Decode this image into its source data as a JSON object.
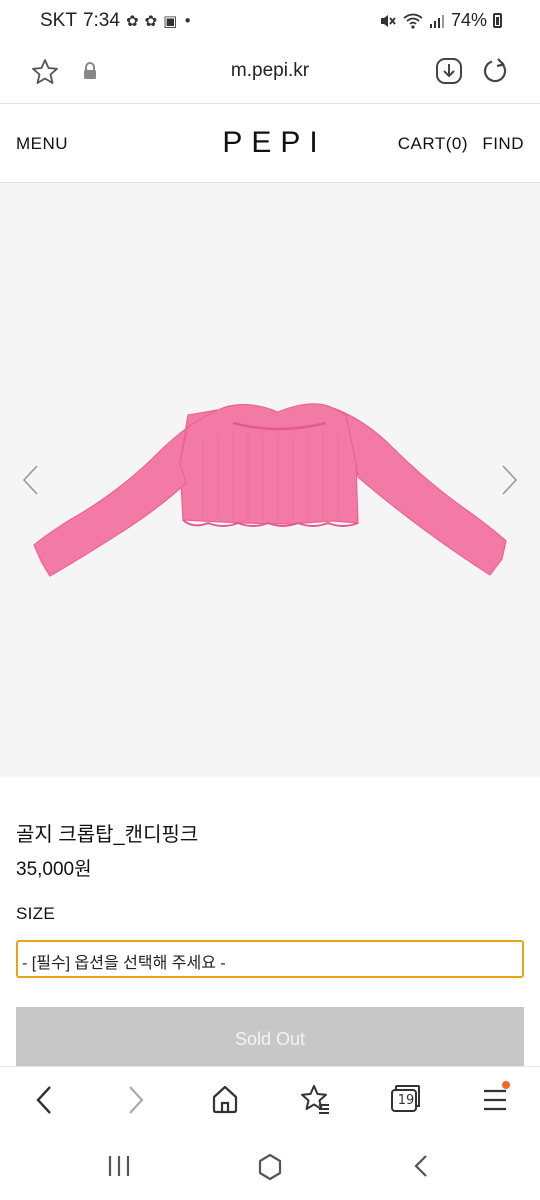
{
  "status_bar": {
    "carrier": "SKT",
    "time": "7:34",
    "battery": "74%"
  },
  "browser": {
    "url": "m.pepi.kr",
    "tab_count": "19"
  },
  "header": {
    "menu": "MENU",
    "logo": "PEPI",
    "cart": "CART(0)",
    "find": "FIND"
  },
  "product": {
    "name": "골지 크롭탑_캔디핑크",
    "price": "35,000원",
    "size_label": "SIZE",
    "size_option": "- [필수] 옵션을 선택해 주세요 -",
    "button": "Sold Out",
    "garment_color": "#f47aa6"
  },
  "colors": {
    "select_border": "#e8a317",
    "sold_out_bg": "#c7c7c7",
    "notify_dot": "#f26b21"
  }
}
